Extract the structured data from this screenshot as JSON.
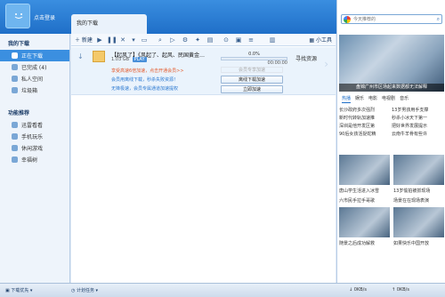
{
  "titlebar": {
    "login_text": "点击登录",
    "min_icon": "minimize-icon",
    "max_icon": "maximize-icon",
    "close_icon": "close-icon"
  },
  "main_tab": {
    "label": "我的下载"
  },
  "sidebar": {
    "section1": "我的下载",
    "items1": [
      {
        "label": "正在下载",
        "active": true
      },
      {
        "label": "已完成 (4)"
      },
      {
        "label": "私人空间"
      },
      {
        "label": "垃圾箱"
      }
    ],
    "section2": "功能推荐",
    "items2": [
      {
        "label": "迅雷看看"
      },
      {
        "label": "手机玩乐"
      },
      {
        "label": "休闲游戏"
      },
      {
        "label": "幸福树"
      }
    ]
  },
  "toolbar": {
    "new_label": "新建",
    "tools_label": "小工具"
  },
  "task": {
    "name": "【起风了】《风起了、起风、民国黄金…",
    "size": "1.03 GB",
    "play_label": "PLAY",
    "progress_pct": "0.0%",
    "progress_value": 0.0,
    "time": "00:00:00",
    "find_source": "寻找资源",
    "promo1": "享受高速6倍加速，点击开通会员>>",
    "promo2": "会员用离线下载，秒杀失败资源！",
    "promo3": "无锋极速，会员专属通道加速提权",
    "hint_box": "会员专享加速",
    "btn_offline": "离线下载加速",
    "btn_accel": "立即加速"
  },
  "rightpanel": {
    "search_placeholder": "今天推荐的",
    "hero_caption": "盘锦广州市区场起来数据都无法解释",
    "tabs": [
      "热播",
      "娱乐",
      "电影",
      "电视剧",
      "音乐"
    ],
    "news": [
      [
        "长沙政府多次强烈",
        "13岁男孩用手支撑"
      ],
      [
        "新时代转轨加速推",
        "秒杀小冰天下第一"
      ],
      [
        "深圳是他开发区第",
        "把好世界发展提示"
      ],
      [
        "90后女孩活捉蛇精",
        "云南牛羊骨有些许"
      ]
    ],
    "thumb_caps": [
      [
        "唐山学生活进入冰雪",
        "13岁偷拍被抓现场"
      ],
      [
        "六市民手拉手哥歌",
        "场景在在现场表演"
      ],
      [
        "",
        ""
      ],
      [
        "随景之后成功解救",
        "如果快乐中国开放"
      ]
    ]
  },
  "statusbar": {
    "left": "下载优先",
    "mid": "计划任务",
    "speed1": "0KB/s",
    "speed2": "0KB/s"
  }
}
